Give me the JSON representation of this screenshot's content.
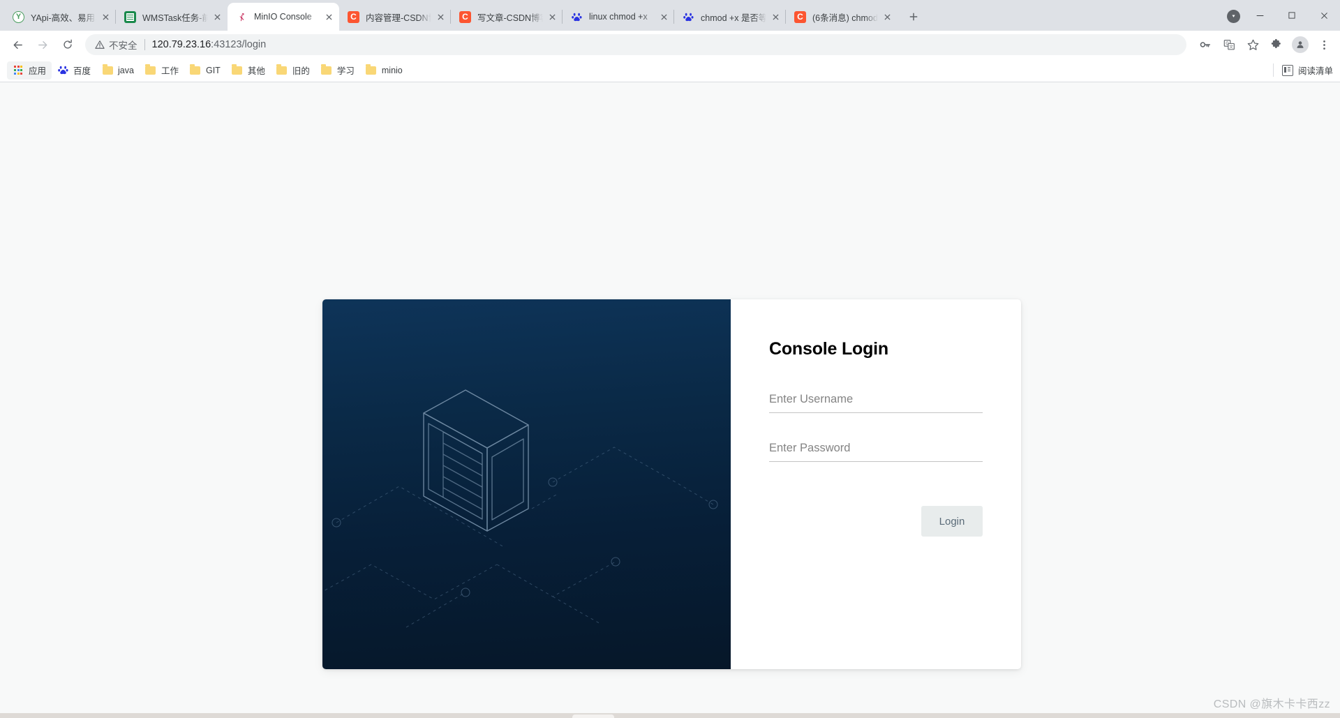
{
  "browser": {
    "tabs": [
      {
        "title": "YApi-高效、易用、",
        "favicon": "yapi-icon",
        "active": false
      },
      {
        "title": "WMSTask任务-前",
        "favicon": "sheets-icon",
        "active": false
      },
      {
        "title": "MinIO Console",
        "favicon": "minio-flamingo-icon",
        "active": true
      },
      {
        "title": "内容管理-CSDN博",
        "favicon": "csdn-icon",
        "active": false
      },
      {
        "title": "写文章-CSDN博客",
        "favicon": "csdn-icon",
        "active": false
      },
      {
        "title": "linux chmod +x",
        "favicon": "baidu-icon",
        "active": false
      },
      {
        "title": "chmod +x 是否等",
        "favicon": "baidu-icon",
        "active": false
      },
      {
        "title": "(6条消息) chmod",
        "favicon": "csdn-icon",
        "active": false
      }
    ],
    "new_tab_label": "+",
    "window_controls": {
      "profile": "profile-avatar",
      "minimize": "−",
      "maximize": "❐",
      "close": "✕"
    },
    "toolbar": {
      "back": "back-arrow-icon",
      "forward": "forward-arrow-icon",
      "reload": "reload-icon",
      "security_label": "不安全",
      "url_host": "120.79.23.16",
      "url_rest": ":43123/login",
      "icons": [
        "key-icon",
        "translate-icon",
        "bookmark-star-icon",
        "extensions-puzzle-icon",
        "profile-avatar-icon",
        "chrome-menu-icon"
      ]
    },
    "bookmarks": {
      "items": [
        {
          "label": "应用",
          "icon": "apps-grid-icon"
        },
        {
          "label": "百度",
          "icon": "baidu-icon"
        },
        {
          "label": "java",
          "icon": "folder-icon"
        },
        {
          "label": "工作",
          "icon": "folder-icon"
        },
        {
          "label": "GIT",
          "icon": "folder-icon"
        },
        {
          "label": "其他",
          "icon": "folder-icon"
        },
        {
          "label": "旧的",
          "icon": "folder-icon"
        },
        {
          "label": "学习",
          "icon": "folder-icon"
        },
        {
          "label": "minio",
          "icon": "folder-icon"
        }
      ],
      "reading_list": "阅读清单"
    }
  },
  "page": {
    "background": "#f8f9f9",
    "login": {
      "title": "Console Login",
      "username": {
        "placeholder": "Enter Username",
        "value": ""
      },
      "password": {
        "placeholder": "Enter Password",
        "value": ""
      },
      "submit_label": "Login",
      "submit_bg": "#e8ecec",
      "panel_gradient_from": "#0e3459",
      "panel_gradient_to": "#061729",
      "illustration": "isometric-server-rack-icon"
    },
    "watermark": "CSDN @旗木卡卡西zz"
  }
}
